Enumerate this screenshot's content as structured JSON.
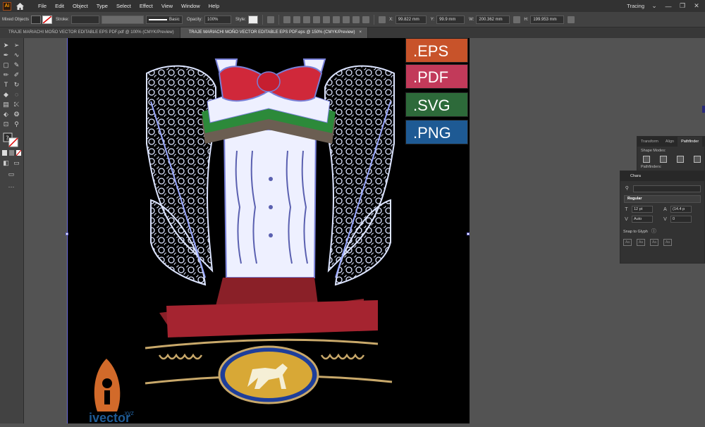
{
  "menubar": {
    "app_icon": "Ai",
    "items": [
      "File",
      "Edit",
      "Object",
      "Type",
      "Select",
      "Effect",
      "View",
      "Window",
      "Help"
    ],
    "workspace": "Tracing"
  },
  "control_bar": {
    "selection_label": "Mixed Objects",
    "stroke_label": "Stroke:",
    "brush_label": "Basic",
    "opacity_label": "Opacity:",
    "opacity_value": "100%",
    "style_label": "Style:",
    "x_label": "X:",
    "x_value": "99.822 mm",
    "y_label": "Y:",
    "y_value": "99.9 mm",
    "w_label": "W:",
    "w_value": "200.362 mm",
    "h_label": "H:",
    "h_value": "199.953 mm"
  },
  "tabs": [
    {
      "label": "TRAJE MARIACHI MOÑO VECTOR EDITABLE EPS PDF.pdf @ 100% (CMYK/Preview)",
      "active": false
    },
    {
      "label": "TRAJE MARIACHI MOÑO VECTOR EDITABLE EPS PDF.eps @ 150% (CMYK/Preview)",
      "active": true
    }
  ],
  "tab_close": "×",
  "badges": [
    {
      "label": ".EPS",
      "color": "#c8532a"
    },
    {
      "label": ".PDF",
      "color": "#c23a5a"
    },
    {
      "label": ".SVG",
      "color": "#2d6a3a"
    },
    {
      "label": ".PNG",
      "color": "#1e5a94"
    }
  ],
  "artwork": {
    "logo_text": "ivector",
    "logo_suffix": ".xyz"
  },
  "pathfinder_panel": {
    "tabs": [
      "Transform",
      "Align",
      "Pathfinder"
    ],
    "shape_modes": "Shape Modes:",
    "pathfinders": "Pathfinders:"
  },
  "character_panel": {
    "title": "Chara",
    "style": "Regular",
    "font_size": "12 pt",
    "leading": "(14.4 p",
    "kerning": "Auto",
    "tracking": "0",
    "snap": "Snap to Glyph"
  }
}
